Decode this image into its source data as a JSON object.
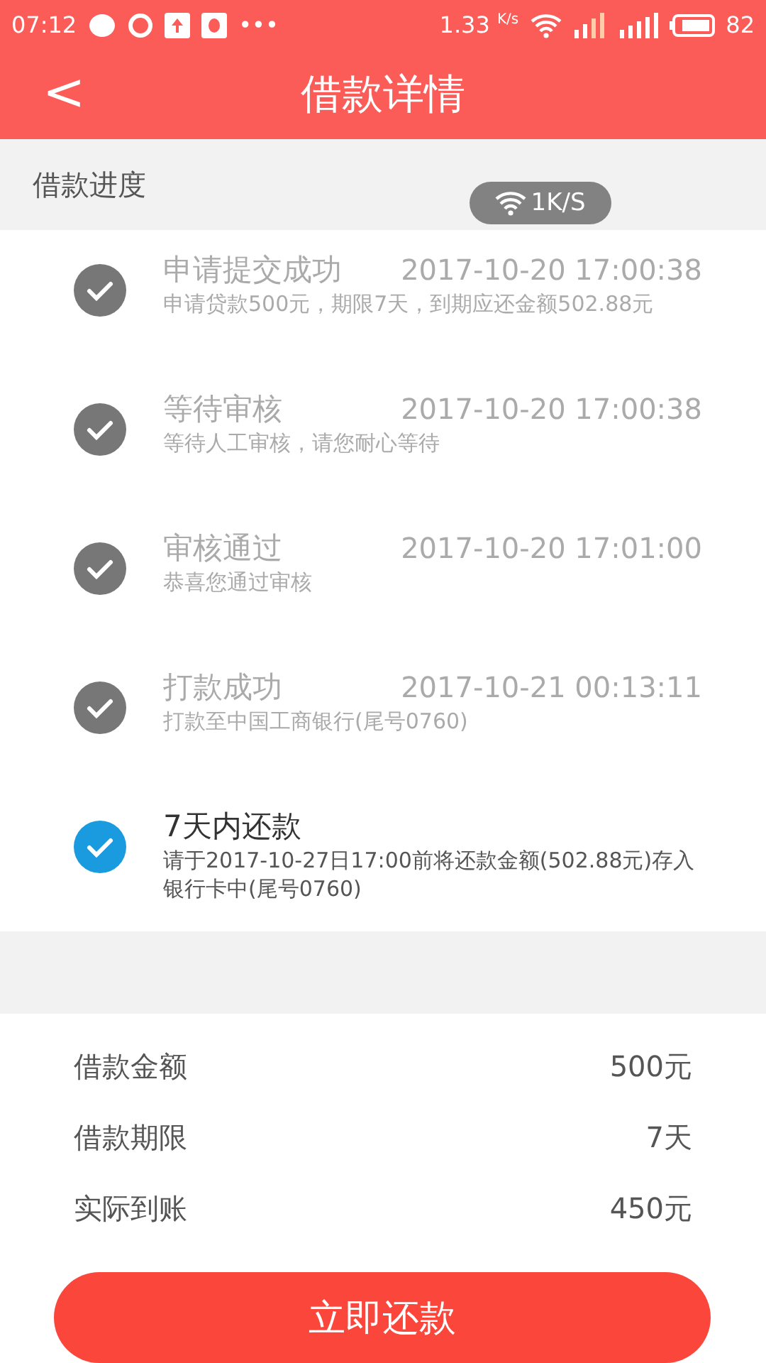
{
  "status_bar": {
    "time": "07:12",
    "more": "•••",
    "speed": "1.33",
    "speed_unit": "K/s",
    "battery": "82"
  },
  "header": {
    "back": "<",
    "title": "借款详情"
  },
  "section_title": "借款进度",
  "speed_overlay": "1K/S",
  "steps": [
    {
      "title": "申请提交成功",
      "time": "2017-10-20 17:00:38",
      "detail": "申请贷款500元，期限7天，到期应还金额502.88元",
      "kind": "done"
    },
    {
      "title": "等待审核",
      "time": "2017-10-20 17:00:38",
      "detail": "等待人工审核，请您耐心等待",
      "kind": "done"
    },
    {
      "title": "审核通过",
      "time": "2017-10-20 17:01:00",
      "detail": "恭喜您通过审核",
      "kind": "done"
    },
    {
      "title": "打款成功",
      "time": "2017-10-21 00:13:11",
      "detail": "打款至中国工商银行(尾号0760)",
      "kind": "done"
    },
    {
      "title": "7天内还款",
      "detail": "请于2017-10-27日17:00前将还款金额(502.88元)存入银行卡中(尾号0760)",
      "kind": "current"
    }
  ],
  "details": [
    {
      "label": "借款金额",
      "value": "500元"
    },
    {
      "label": "借款期限",
      "value": "7天"
    },
    {
      "label": "实际到账",
      "value": "450元"
    }
  ],
  "repay_button": "立即还款"
}
